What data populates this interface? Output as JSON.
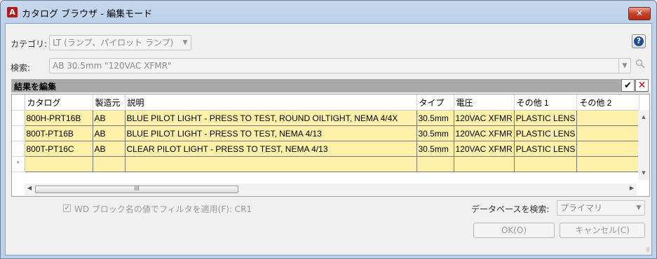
{
  "window": {
    "title": "カタログ ブラウザ - 編集モード",
    "close_label": "✕",
    "app_icon_letter": "A"
  },
  "category": {
    "label": "カテゴリ:",
    "value": "LT (ランプ、パイロット ランプ)"
  },
  "search": {
    "label": "検索:",
    "value": "AB 30.5mm \"120VAC XFMR\""
  },
  "results": {
    "title": "結果を編集",
    "accept_glyph": "✔",
    "discard_glyph": "✕"
  },
  "table": {
    "columns": [
      "カタログ",
      "製造元",
      "説明",
      "タイプ",
      "電圧",
      "その他 1",
      "その他 2"
    ],
    "rows": [
      [
        "800H-PRT16B",
        "AB",
        "BLUE PILOT LIGHT - PRESS TO TEST, ROUND OILTIGHT, NEMA 4/4X",
        "30.5mm",
        "120VAC XFMR",
        "PLASTIC LENS",
        ""
      ],
      [
        "800T-PT16B",
        "AB",
        "BLUE PILOT LIGHT - PRESS TO TEST, NEMA 4/13",
        "30.5mm",
        "120VAC XFMR",
        "PLASTIC LENS",
        ""
      ],
      [
        "800T-PT16C",
        "AB",
        "CLEAR PILOT LIGHT - PRESS TO TEST, NEMA 4/13",
        "30.5mm",
        "120VAC XFMR",
        "PLASTIC LENS",
        ""
      ]
    ],
    "new_row_marker": "*",
    "hscroll_grip": "III"
  },
  "filter": {
    "label": "WD ブロック名の値でフィルタを適用(F): CR1",
    "checked": true
  },
  "database": {
    "label": "データベースを検索:",
    "value": "プライマリ"
  },
  "buttons": {
    "ok": "OK(O)",
    "cancel": "キャンセル(C)"
  },
  "colors": {
    "row_fill": "#fdf0a9",
    "section_header": "#a9a9a9",
    "close_red": "#c8402a"
  }
}
